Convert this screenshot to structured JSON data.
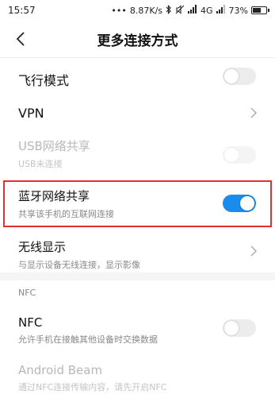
{
  "status": {
    "time": "15:57",
    "dots": "•••",
    "speed": "8.87K/s",
    "network": "4G",
    "battery": "73%",
    "battery_level": 0.73
  },
  "header": {
    "title": "更多连接方式"
  },
  "rows": {
    "airplane": {
      "title": "飞行模式"
    },
    "vpn": {
      "title": "VPN"
    },
    "usb": {
      "title": "USB网络共享",
      "subtitle": "USB未连接"
    },
    "bluetooth": {
      "title": "蓝牙网络共享",
      "subtitle": "共享该手机的互联网连接"
    },
    "wireless_display": {
      "title": "无线显示",
      "subtitle": "与显示设备无线连接，显示影像"
    },
    "nfc_section": {
      "label": "NFC"
    },
    "nfc": {
      "title": "NFC",
      "subtitle": "允许手机在接触其他设备时交换数据"
    },
    "android_beam": {
      "title": "Android Beam",
      "subtitle": "通过NFC连接传输内容，请先开启NFC"
    }
  },
  "colors": {
    "toggle_on": "#1b8bed",
    "highlight": "#e0312f"
  }
}
